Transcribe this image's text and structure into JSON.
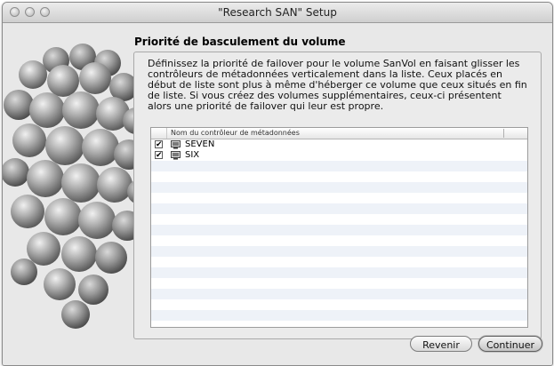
{
  "window": {
    "title": "\"Research SAN\" Setup"
  },
  "panel": {
    "title": "Priorité de basculement du volume",
    "description": "Définissez la priorité de failover pour le volume SanVol en faisant glisser les contrôleurs de métadonnées verticalement dans la liste. Ceux placés en début de liste sont plus à même d'héberger ce volume que ceux situés en fin de liste. Si vous créez des volumes supplémentaires, ceux-ci présentent alors une priorité de failover qui leur est propre."
  },
  "list": {
    "column_header": "Nom du contrôleur de métadonnées",
    "items": [
      {
        "label": "SEVEN",
        "checked": true,
        "icon": "server-icon"
      },
      {
        "label": "SIX",
        "checked": true,
        "icon": "server-icon"
      }
    ]
  },
  "buttons": {
    "back": "Revenir",
    "continue": "Continuer"
  }
}
